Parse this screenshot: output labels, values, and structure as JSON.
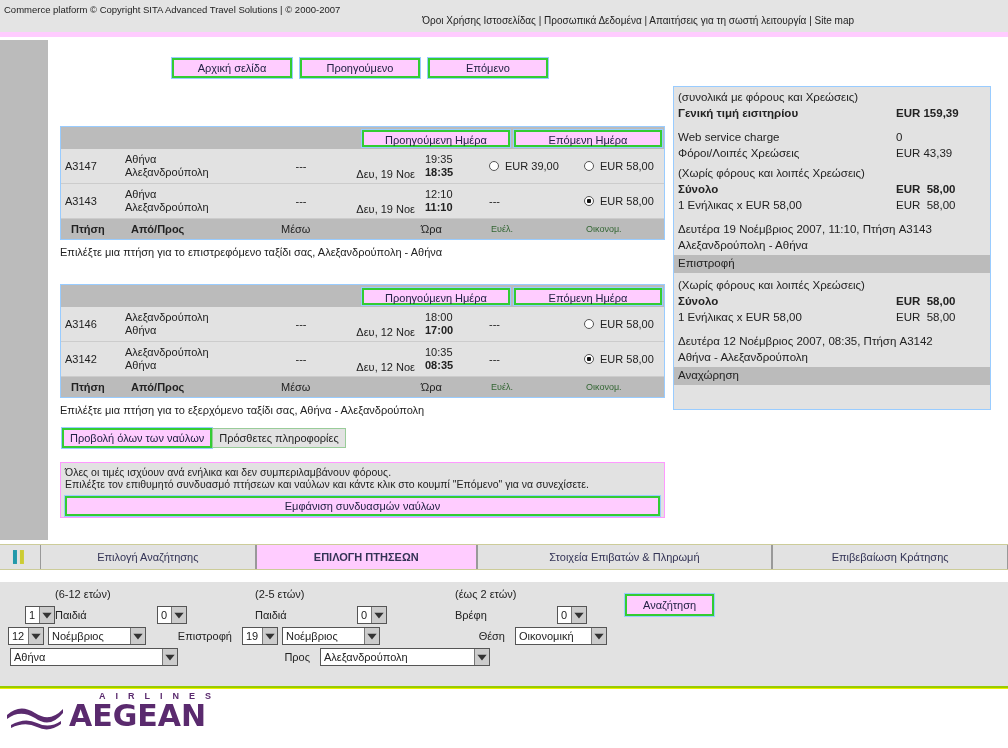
{
  "footer": {
    "copyright": "Commerce platform © Copyright SITA Advanced Travel Solutions | © 2000-2007",
    "links": "Όροι Χρήσης Ιστοσελίδας | Προσωπικά Δεδομένα | Απαιτήσεις για τη σωστή λειτουργία | Site map"
  },
  "nav_buttons": [
    "Αρχική σελίδα",
    "Προηγούμενο",
    "Επόμενο"
  ],
  "summary": {
    "grand_note": "(συνολικά με φόρους και Χρεώσεις)",
    "grand_label": "Γενική τιμή εισιτηρίου",
    "grand_amount": "EUR 159,39",
    "charges": [
      {
        "label": "Web service charge",
        "amount": "0"
      },
      {
        "label": "Φόροι/Λοιπές Χρεώσεις",
        "amount": "EUR 43,39"
      }
    ],
    "legs": [
      {
        "note": "(Χωρίς φόρους και λοιπές Χρεώσεις)",
        "total_label": "Σύνολο",
        "total_amount": "EUR  58,00",
        "fare_label": "1 Ενήλικας  x   EUR 58,00",
        "fare_amount": "EUR  58,00",
        "detail": "Δευτέρα 19 Νοέμβριος 2007, 11:10, Πτήση A3143",
        "route": "Αλεξανδρούπολη - Αθήνα",
        "title": "Επιστροφή"
      },
      {
        "note": "(Χωρίς φόρους και λοιπές Χρεώσεις)",
        "total_label": "Σύνολο",
        "total_amount": "EUR  58,00",
        "fare_label": "1 Ενήλικας  x   EUR 58,00",
        "fare_amount": "EUR  58,00",
        "detail": "Δευτέρα 12 Νοέμβριος 2007, 08:35, Πτήση A3142",
        "route": "Αθήνα - Αλεξανδρούπολη",
        "title": "Αναχώρηση"
      }
    ]
  },
  "journeys": [
    {
      "buttons": [
        "Προηγούμενη Ημέρα",
        "Επόμενη Ημέρα"
      ],
      "rows": [
        {
          "flight": "A3147",
          "to": "Αθήνα",
          "from": "Αλεξανδρούπολη",
          "via": "---",
          "date": "Δευ, 19 Νοε",
          "arrive": "19:35",
          "depart": "18:35",
          "fares": [
            {
              "kind": "fare",
              "price": "EUR 39,00",
              "selected": false
            },
            {
              "kind": "fare",
              "price": "EUR 58,00",
              "selected": false
            }
          ]
        },
        {
          "flight": "A3143",
          "to": "Αθήνα",
          "from": "Αλεξανδρούπολη",
          "via": "---",
          "date": "Δευ, 19 Νοε",
          "arrive": "12:10",
          "depart": "11:10",
          "fares": [
            {
              "kind": "none",
              "text": "---"
            },
            {
              "kind": "fare",
              "price": "EUR 58,00",
              "selected": true
            }
          ]
        }
      ],
      "columns": [
        "Πτήση",
        "Από/Προς",
        "Μέσω",
        "Ώρα",
        "Ευέλ.",
        "Οικονομ."
      ],
      "heading": "Επιλέξτε μια πτήση για το επιστρεφόμενο ταξίδι σας, Αλεξανδρούπολη - Αθήνα"
    },
    {
      "buttons": [
        "Προηγούμενη Ημέρα",
        "Επόμενη Ημέρα"
      ],
      "rows": [
        {
          "flight": "A3146",
          "to": "Αλεξανδρούπολη",
          "from": "Αθήνα",
          "via": "---",
          "date": "Δευ, 12 Νοε",
          "arrive": "18:00",
          "depart": "17:00",
          "fares": [
            {
              "kind": "none",
              "text": "---"
            },
            {
              "kind": "fare",
              "price": "EUR 58,00",
              "selected": false
            }
          ]
        },
        {
          "flight": "A3142",
          "to": "Αλεξανδρούπολη",
          "from": "Αθήνα",
          "via": "---",
          "date": "Δευ, 12 Νοε",
          "arrive": "10:35",
          "depart": "08:35",
          "fares": [
            {
              "kind": "none",
              "text": "---"
            },
            {
              "kind": "fare",
              "price": "EUR 58,00",
              "selected": true
            }
          ]
        }
      ],
      "columns": [
        "Πτήση",
        "Από/Προς",
        "Μέσω",
        "Ώρα",
        "Ευέλ.",
        "Οικονομ."
      ],
      "heading": "Επιλέξτε μια πτήση για το εξερχόμενο ταξίδι σας, Αθήνα - Αλεξανδρούπολη"
    }
  ],
  "week_buttons": [
    {
      "label": "Προβολή όλων των ναύλων",
      "selected": true
    },
    {
      "label": "Πρόσθετες πληροφορίες",
      "selected": false
    }
  ],
  "info": {
    "lines": [
      "Όλες οι τιμές ισχύουν ανά ενήλικα και δεν συμπεριλαμβάνουν φόρους.",
      "Επιλέξτε τον επιθυμητό συνδυασμό πτήσεων και ναύλων και κάντε κλικ στο κουμπί \"Επόμενο\" για να συνεχίσετε."
    ],
    "button": "Εμφάνιση συνδυασμών ναύλων"
  },
  "tabs": [
    {
      "label": "Επιλογή Αναζήτησης",
      "selected": false
    },
    {
      "label": "ΕΠΙΛΟΓΗ ΠΤΗΣΕΩΝ",
      "selected": true
    },
    {
      "label": "Στοιχεία Επιβατών & Πληρωμή",
      "selected": false
    },
    {
      "label": "Επιβεβαίωση Κράτησης",
      "selected": false
    }
  ],
  "search": {
    "passengers": [
      {
        "note": "(6-12 ετών)",
        "label": "Παιδιά",
        "value": "0"
      },
      {
        "note": "(2-5 ετών)",
        "label": "Παιδιά",
        "value": "0"
      },
      {
        "note": "(έως 2 ετών)",
        "label": "Βρέφη",
        "value": "0"
      }
    ],
    "adults": "1",
    "button": "Αναζήτηση",
    "depart_day": "12",
    "depart_month": "Νοέμβριος",
    "return_label": "Επιστροφή",
    "return_day": "19",
    "return_month": "Νοέμβριος",
    "class_label": "Θέση",
    "class_value": "Οικονομική",
    "from_value": "Αθήνα",
    "to_label": "Προς",
    "to_value": "Αλεξανδρούπολη"
  },
  "logo": {
    "tagline": "AIRLINES",
    "name": "AEGEAN"
  }
}
